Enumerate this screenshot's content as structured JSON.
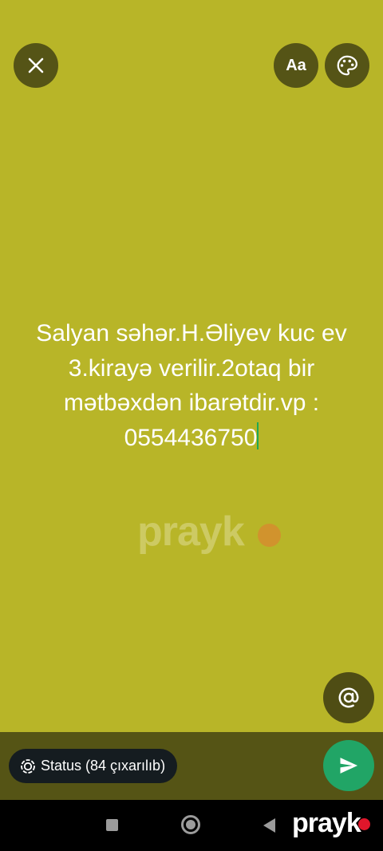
{
  "toolbar": {
    "close_icon": "close-icon",
    "font_label": "Aa",
    "palette_icon": "palette-icon"
  },
  "status": {
    "text": "Salyan səhər.H.Əliyev kuc ev 3.kirayə verilir.2otaq bir mətbəxdən ibarətdir.vp : 0554436750",
    "background_color": "#b8b528",
    "text_color": "#ffffff",
    "cursor_color": "#1fa855"
  },
  "watermark": {
    "text": "prayk"
  },
  "mention": {
    "icon": "at-sign-icon"
  },
  "footer": {
    "audience_label": "Status (84 çıxarılıb)",
    "send_icon": "send-icon",
    "send_color": "#21a566"
  },
  "nav": {
    "recents_icon": "square-icon",
    "home_icon": "circle-icon",
    "back_icon": "triangle-back-icon",
    "brand": "prayk"
  }
}
